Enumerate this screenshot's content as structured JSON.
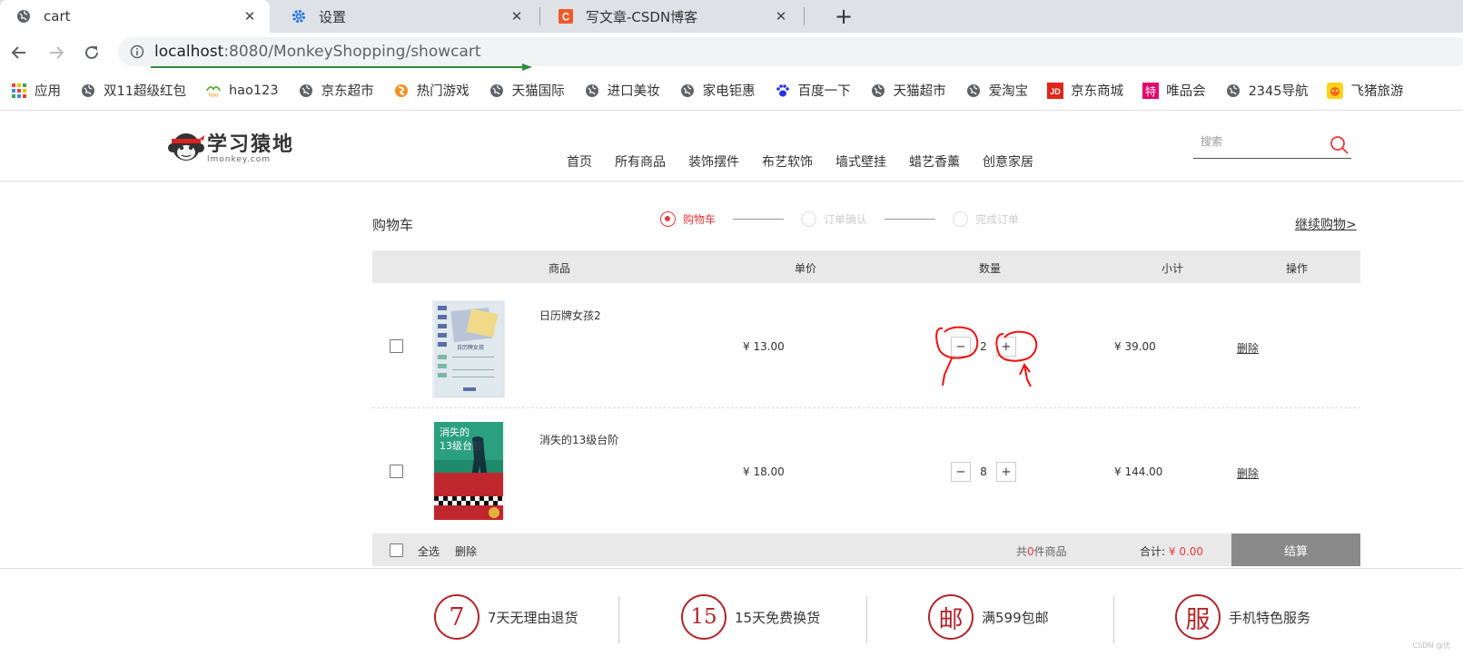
{
  "browser": {
    "tabs": [
      {
        "title": "cart",
        "icon": "globe-icon",
        "active": true
      },
      {
        "title": "设置",
        "icon": "gear-icon",
        "active": false
      },
      {
        "title": "写文章-CSDN博客",
        "icon": "csdn-icon",
        "active": false
      }
    ],
    "url_host": "localhost",
    "url_rest": ":8080/MonkeyShopping/showcart",
    "bookmarks": [
      {
        "label": "应用",
        "icon": "apps-grid-icon"
      },
      {
        "label": "双11超级红包",
        "icon": "globe-icon"
      },
      {
        "label": "hao123",
        "icon": "hao123-icon"
      },
      {
        "label": "京东超市",
        "icon": "globe-icon"
      },
      {
        "label": "热门游戏",
        "icon": "game-icon"
      },
      {
        "label": "天猫国际",
        "icon": "globe-icon"
      },
      {
        "label": "进口美妆",
        "icon": "globe-icon"
      },
      {
        "label": "家电钜惠",
        "icon": "globe-icon"
      },
      {
        "label": "百度一下",
        "icon": "baidu-paw-icon"
      },
      {
        "label": "天猫超市",
        "icon": "globe-icon"
      },
      {
        "label": "爱淘宝",
        "icon": "globe-icon"
      },
      {
        "label": "京东商城",
        "icon": "jd-icon"
      },
      {
        "label": "唯品会",
        "icon": "vip-icon"
      },
      {
        "label": "2345导航",
        "icon": "globe-icon"
      },
      {
        "label": "飞猪旅游",
        "icon": "fliggy-icon"
      }
    ]
  },
  "site": {
    "logo_text": "学习猿地",
    "logo_sub": "lmonkey.com",
    "nav": [
      "首页",
      "所有商品",
      "装饰摆件",
      "布艺软饰",
      "墙式壁挂",
      "蜡艺香薰",
      "创意家居"
    ],
    "search_placeholder": "搜索"
  },
  "cart": {
    "title": "购物车",
    "steps": [
      "购物车",
      "订单确认",
      "完成订单"
    ],
    "continue_link": "继续购物>",
    "headers": {
      "product": "商品",
      "unit_price": "单价",
      "quantity": "数量",
      "subtotal": "小计",
      "action": "操作"
    },
    "items": [
      {
        "name": "日历牌女孩2",
        "price": "¥ 13.00",
        "qty": "2",
        "subtotal": "¥ 39.00",
        "delete": "删除",
        "minus": "−",
        "plus": "+"
      },
      {
        "name": "消失的13级台阶",
        "price": "¥ 18.00",
        "qty": "8",
        "subtotal": "¥ 144.00",
        "delete": "删除",
        "minus": "−",
        "plus": "+"
      }
    ],
    "footer": {
      "select_all": "全选",
      "delete": "删除",
      "count_prefix": "共",
      "count": "0",
      "count_suffix": "件商品",
      "total_label": "合计:",
      "total": "¥ 0.00",
      "checkout": "结算"
    },
    "book_covers": [
      {
        "title": "日历牌女孩",
        "colors": {
          "bg": "#dfe9ee",
          "accent": "#5b6ea8"
        }
      },
      {
        "title": "消失的13级台阶",
        "colors": {
          "bg": "#1f8a6a",
          "accent": "#c0262d"
        }
      }
    ]
  },
  "services": [
    {
      "glyph": "7",
      "text": "7天无理由退货"
    },
    {
      "glyph": "15",
      "text": "15天免费换货"
    },
    {
      "glyph": "邮",
      "text": "满599包邮"
    },
    {
      "glyph": "服",
      "text": "手机特色服务"
    }
  ],
  "watermark": "CSDN @优",
  "colors": {
    "accent": "#e4393c",
    "service": "#b0252a",
    "checkout": "#898989"
  }
}
